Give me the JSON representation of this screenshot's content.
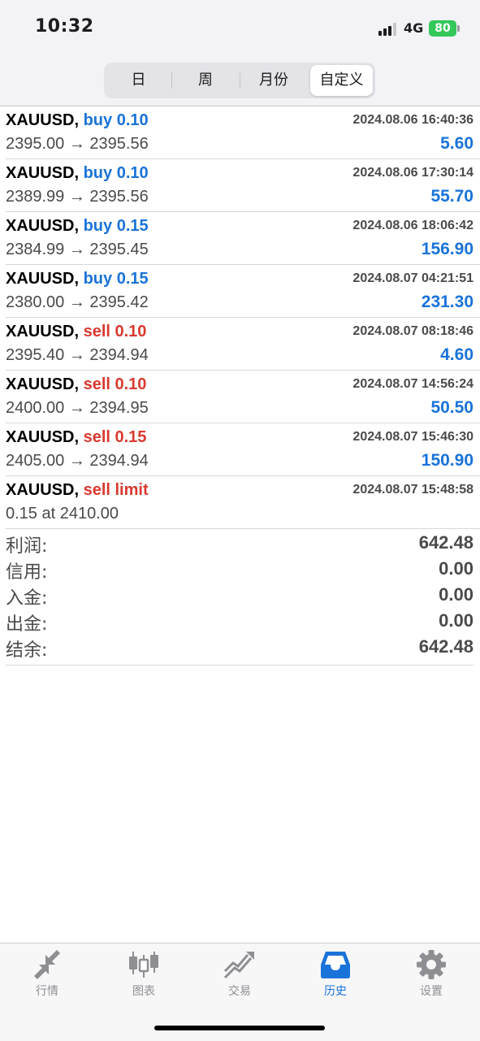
{
  "status": {
    "time": "10:32",
    "network": "4G",
    "battery": "80"
  },
  "segments": [
    "日",
    "周",
    "月份",
    "自定义"
  ],
  "active_segment": "自定义",
  "trades": [
    {
      "symbol": "XAUUSD,",
      "type": "buy 0.10",
      "side": "buy",
      "time": "2024.08.06 16:40:36",
      "price": "2395.00 → 2395.56",
      "profit": "5.60"
    },
    {
      "symbol": "XAUUSD,",
      "type": "buy 0.10",
      "side": "buy",
      "time": "2024.08.06 17:30:14",
      "price": "2389.99 → 2395.56",
      "profit": "55.70"
    },
    {
      "symbol": "XAUUSD,",
      "type": "buy 0.15",
      "side": "buy",
      "time": "2024.08.06 18:06:42",
      "price": "2384.99 → 2395.45",
      "profit": "156.90"
    },
    {
      "symbol": "XAUUSD,",
      "type": "buy 0.15",
      "side": "buy",
      "time": "2024.08.07 04:21:51",
      "price": "2380.00 → 2395.42",
      "profit": "231.30"
    },
    {
      "symbol": "XAUUSD,",
      "type": "sell 0.10",
      "side": "sell",
      "time": "2024.08.07 08:18:46",
      "price": "2395.40 → 2394.94",
      "profit": "4.60"
    },
    {
      "symbol": "XAUUSD,",
      "type": "sell 0.10",
      "side": "sell",
      "time": "2024.08.07 14:56:24",
      "price": "2400.00 → 2394.95",
      "profit": "50.50"
    },
    {
      "symbol": "XAUUSD,",
      "type": "sell 0.15",
      "side": "sell",
      "time": "2024.08.07 15:46:30",
      "price": "2405.00 → 2394.94",
      "profit": "150.90"
    },
    {
      "symbol": "XAUUSD,",
      "type": "sell limit",
      "side": "sell",
      "time": "2024.08.07 15:48:58",
      "price": "0.15 at 2410.00",
      "profit": ""
    }
  ],
  "summary": [
    {
      "label": "利润:",
      "value": "642.48"
    },
    {
      "label": "信用:",
      "value": "0.00"
    },
    {
      "label": "入金:",
      "value": "0.00"
    },
    {
      "label": "出金:",
      "value": "0.00"
    },
    {
      "label": "结余:",
      "value": "642.48"
    }
  ],
  "tabs": [
    {
      "label": "行情",
      "icon": "quotes-icon"
    },
    {
      "label": "图表",
      "icon": "chart-icon"
    },
    {
      "label": "交易",
      "icon": "trade-icon"
    },
    {
      "label": "历史",
      "icon": "history-icon"
    },
    {
      "label": "设置",
      "icon": "settings-icon"
    }
  ],
  "active_tab": "历史",
  "colors": {
    "buy": "#1a73d9",
    "sell": "#d93a2f",
    "active_tab": "#1a73d9",
    "inactive_tab": "#8e8e93",
    "battery": "#34c759"
  }
}
